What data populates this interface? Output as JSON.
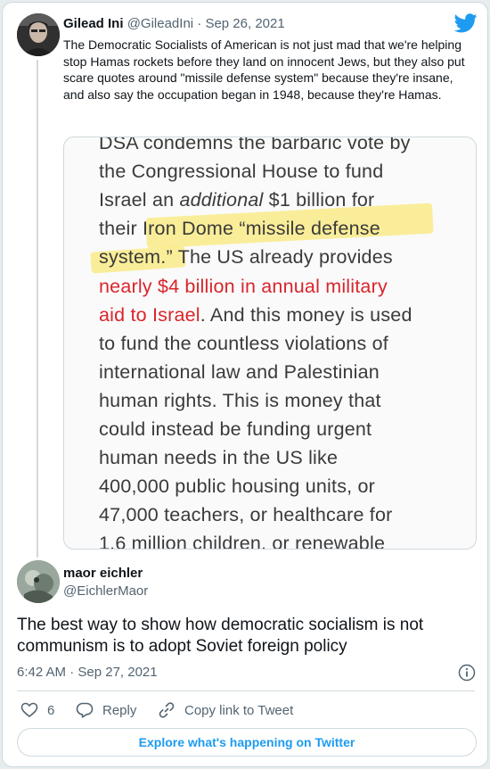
{
  "parent_tweet": {
    "author_name": "Gilead Ini",
    "meta": "@GileadIni · Sep 26, 2021",
    "text": "The Democratic Socialists of American is not just mad that we're helping stop Hamas rockets before they land on innocent Jews, but they also put scare quotes around \"missile defense system\" because they're insane, and also say the occupation began in 1948, because they're Hamas.",
    "image_lines": [
      {
        "parts": [
          {
            "t": "DSA condemns the barbaric vote by"
          }
        ]
      },
      {
        "parts": [
          {
            "t": "the Congressional House to fund"
          }
        ]
      },
      {
        "parts": [
          {
            "t": "Israel an "
          },
          {
            "t": "additional",
            "style": "it"
          },
          {
            "t": " $1 billion for"
          }
        ]
      },
      {
        "parts": [
          {
            "t": "their Iron Dome “missile defense"
          }
        ]
      },
      {
        "parts": [
          {
            "t": "system.” The US already provides"
          }
        ]
      },
      {
        "parts": [
          {
            "t": "nearly $4 billion in annual military",
            "style": "red"
          }
        ]
      },
      {
        "parts": [
          {
            "t": "aid to Israel",
            "style": "red"
          },
          {
            "t": ". And this money is used"
          }
        ]
      },
      {
        "parts": [
          {
            "t": "to fund the countless violations of"
          }
        ]
      },
      {
        "parts": [
          {
            "t": "international law and Palestinian"
          }
        ]
      },
      {
        "parts": [
          {
            "t": "human rights. This is money that"
          }
        ]
      },
      {
        "parts": [
          {
            "t": "could instead be funding urgent"
          }
        ]
      },
      {
        "parts": [
          {
            "t": "human needs in the US like"
          }
        ]
      },
      {
        "parts": [
          {
            "t": "400,000 public housing units, or"
          }
        ]
      },
      {
        "parts": [
          {
            "t": "47,000 teachers, or healthcare for"
          }
        ]
      },
      {
        "parts": [
          {
            "t": "1.6 million children, or renewable"
          }
        ]
      }
    ]
  },
  "reply_tweet": {
    "author_name": "maor eichler",
    "handle": "@EichlerMaor",
    "text": "The best way to show how democratic socialism is not communism is to adopt Soviet foreign policy",
    "timestamp": "6:42 AM · Sep 27, 2021"
  },
  "actions": {
    "like_count": "6",
    "reply_label": "Reply",
    "copy_link_label": "Copy link to Tweet"
  },
  "explore_label": "Explore what's happening on Twitter",
  "colors": {
    "twitter_blue": "#1d9bf0",
    "highlight_yellow": "#fae878",
    "statement_red": "#d9252c"
  },
  "icons": [
    "twitter-bird-icon",
    "info-icon",
    "heart-icon",
    "reply-bubble-icon",
    "link-icon"
  ]
}
